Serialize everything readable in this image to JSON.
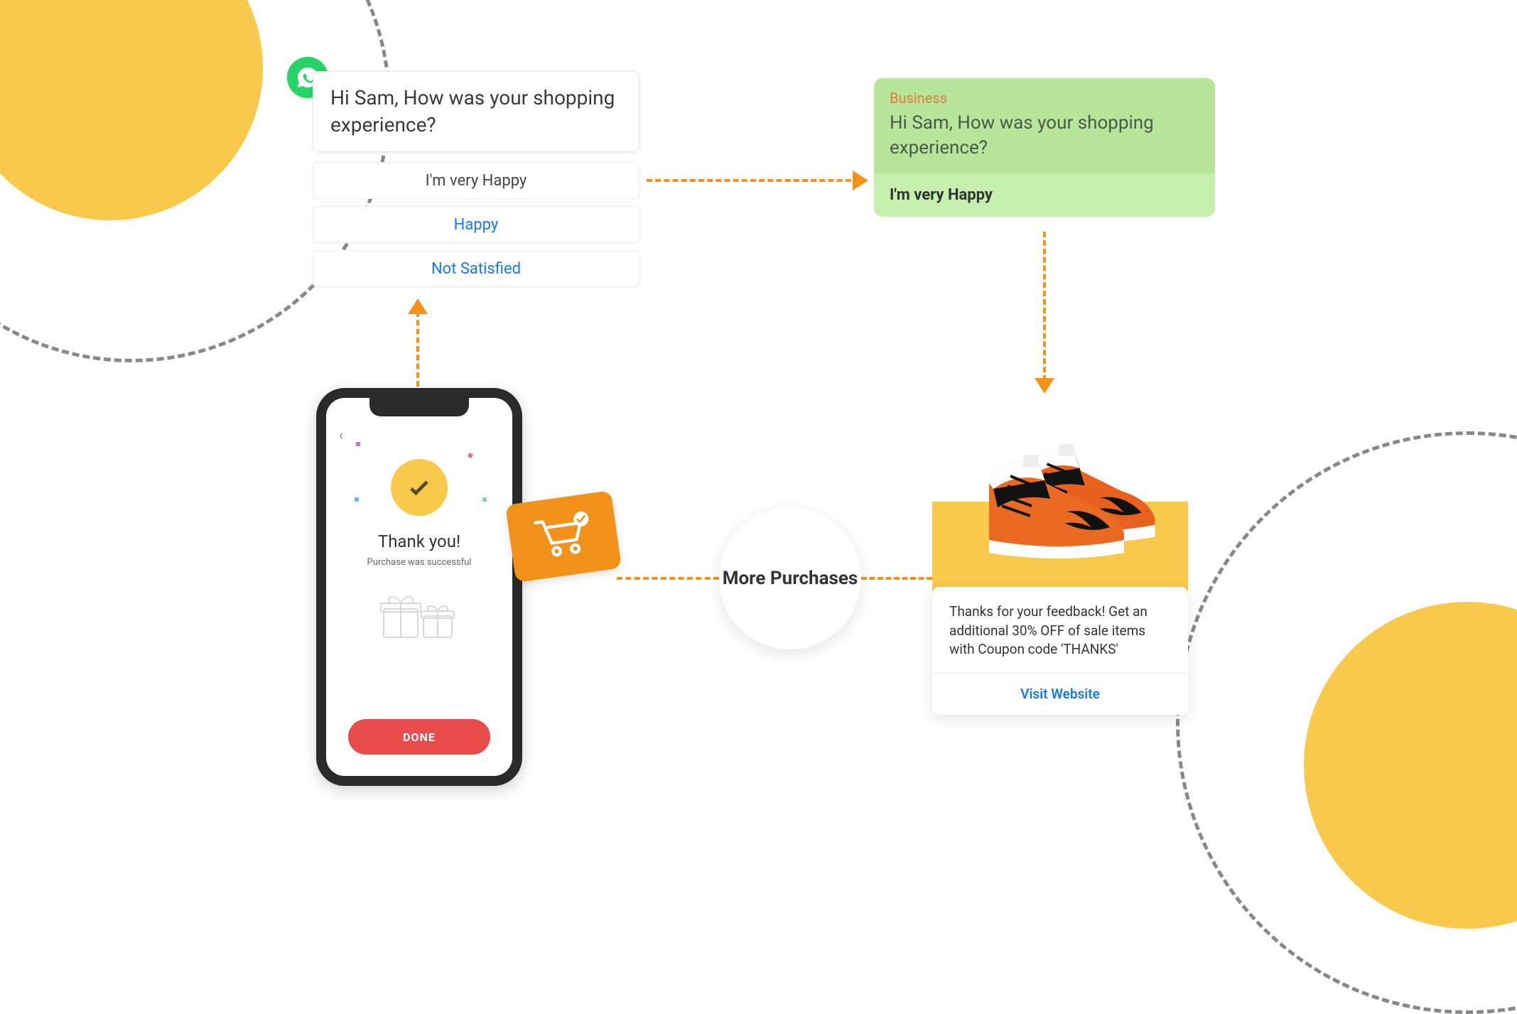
{
  "question_bubble": {
    "text": "Hi Sam, How was your shopping experience?"
  },
  "options": {
    "opt1": "I'm very Happy",
    "opt2": "Happy",
    "opt3": "Not Satisfied"
  },
  "response_card": {
    "sender_label": "Business",
    "question": "Hi Sam, How was your shopping experience?",
    "answer": "I'm very Happy"
  },
  "phone": {
    "title": "Thank you!",
    "subtitle": "Purchase was successful",
    "button": "DONE"
  },
  "center_circle": {
    "text": "More Purchases"
  },
  "product_card": {
    "text": "Thanks for your feedback! Get an additional 30% OFF of sale items with Coupon code 'THANKS'",
    "link": "Visit Website"
  },
  "colors": {
    "orange": "#F2921B",
    "yellow": "#F8C94A",
    "green_light": "#C7F0AE",
    "green_dark": "#B7E69A",
    "link_blue": "#1877F2",
    "red": "#E94B4B",
    "whatsapp": "#25D366"
  }
}
